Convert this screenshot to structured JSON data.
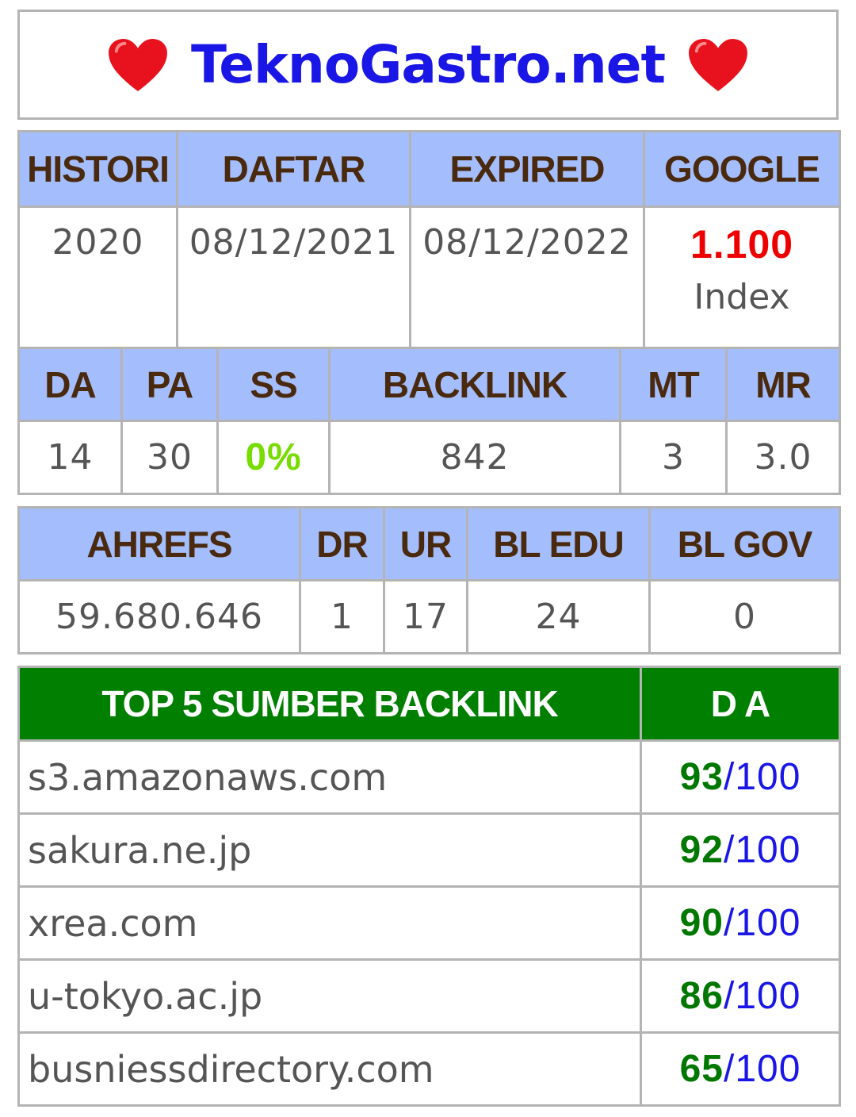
{
  "header": {
    "site": "TeknoGastro.net",
    "heart_icon": "heart-icon",
    "colors": {
      "site": "#1a16e6",
      "heart": "#e8121e"
    }
  },
  "summary": {
    "headers": [
      "HISTORI",
      "DAFTAR",
      "EXPIRED",
      "GOOGLE"
    ],
    "histori": "2020",
    "daftar": "08/12/2021",
    "expired": "08/12/2022",
    "google_value": "1.100",
    "google_label": "Index"
  },
  "metrics": {
    "headers": [
      "DA",
      "PA",
      "SS",
      "BACKLINK",
      "MT",
      "MR"
    ],
    "values": [
      "14",
      "30",
      "0%",
      "842",
      "3",
      "3.0"
    ]
  },
  "ahrefs": {
    "headers": [
      "AHREFS",
      "DR",
      "UR",
      "BL EDU",
      "BL GOV"
    ],
    "values": [
      "59.680.646",
      "1",
      "17",
      "24",
      "0"
    ]
  },
  "top_backlinks": {
    "header_source": "TOP 5 SUMBER BACKLINK",
    "header_da": "D A",
    "rows": [
      {
        "domain": "s3.amazonaws.com",
        "da": "93",
        "max": "100"
      },
      {
        "domain": "sakura.ne.jp",
        "da": "92",
        "max": "100"
      },
      {
        "domain": "xrea.com",
        "da": "90",
        "max": "100"
      },
      {
        "domain": "u-tokyo.ac.jp",
        "da": "86",
        "max": "100"
      },
      {
        "domain": "busniessdirectory.com",
        "da": "65",
        "max": "100"
      }
    ],
    "separator": "/"
  },
  "colors": {
    "header_bg": "#a4bdfc",
    "header_text": "#4a2a0e",
    "top_header_bg": "#007f00",
    "google_value": "#ee0000",
    "ss_value": "#77dd00",
    "da_value": "#007700",
    "da_max": "#1a16e6"
  }
}
